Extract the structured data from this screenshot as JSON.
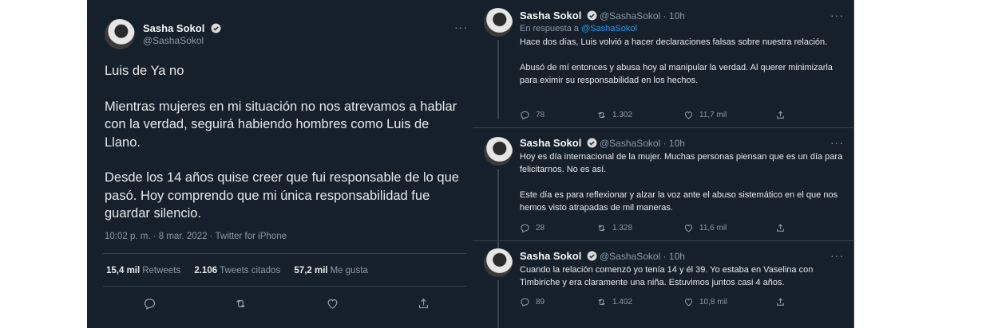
{
  "main_tweet": {
    "author_name": "Sasha Sokol",
    "author_handle": "@SashaSokol",
    "text": "Luis de Ya no\n\nMientras mujeres en mi situación no nos atrevamos a hablar con la verdad, seguirá habiendo hombres como Luis de Llano.\n\nDesde los 14 años quise creer que fui responsable de lo que pasó. Hoy comprendo que mi única responsabilidad fue guardar silencio.",
    "meta": "10:02 p. m. · 8 mar. 2022 · Twitter for iPhone",
    "stats": {
      "retweets_value": "15,4 mil",
      "retweets_label": "Retweets",
      "quotes_value": "2.106",
      "quotes_label": "Tweets citados",
      "likes_value": "57,2 mil",
      "likes_label": "Me gusta"
    }
  },
  "thread": [
    {
      "author_name": "Sasha Sokol",
      "author_handle": "@SashaSokol · 10h",
      "reply_prefix": "En respuesta a",
      "reply_to": "@SashaSokol",
      "text": "Hace dos días, Luis volvió a hacer declaraciones falsas sobre nuestra relación.\n\nAbusó de mí entonces y abusa hoy al manipular la verdad. Al querer minimizarla para eximir su responsabilidad en los hechos.",
      "replies": "78",
      "retweets": "1.302",
      "likes": "11,7 mil"
    },
    {
      "author_name": "Sasha Sokol",
      "author_handle": "@SashaSokol · 10h",
      "text": "Hoy es día internacional de la mujer. Muchas personas piensan que es un día para felicitarnos. No es así.\n\nEste día es para reflexionar y alzar la voz ante el abuso sistemático en el que nos hemos visto atrapadas de mil maneras.",
      "replies": "28",
      "retweets": "1.328",
      "likes": "11,6 mil"
    },
    {
      "author_name": "Sasha Sokol",
      "author_handle": "@SashaSokol · 10h",
      "text": "Cuando la relación comenzó yo tenía 14 y él 39. Yo estaba en Vaselina con Timbiriche y era claramente una niña. Estuvimos juntos casi 4 años.",
      "replies": "89",
      "retweets": "1.402",
      "likes": "10,8 mil"
    }
  ],
  "icons": {
    "more": "more-icon",
    "reply": "reply-icon",
    "retweet": "retweet-icon",
    "like": "like-icon",
    "share": "share-icon",
    "verified": "verified-badge-icon"
  },
  "colors": {
    "background": "#15202b",
    "accent": "#1d9bf0",
    "muted": "#8b98a5"
  }
}
